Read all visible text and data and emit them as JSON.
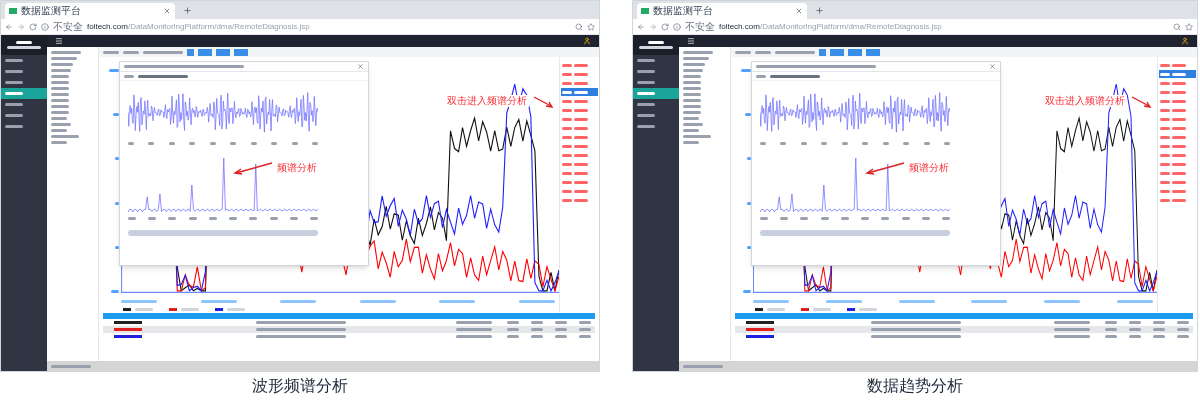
{
  "panels": [
    {
      "browser": {
        "tab_title": "数据监测平台",
        "security": "不安全",
        "url_host": "foltech.com",
        "url_path": "/DataMonitoringPlatform/dma/RemoteDiagnosis.jsp"
      },
      "sidebar": {
        "items": [
          {
            "selected": false
          },
          {
            "selected": false
          },
          {
            "selected": false
          },
          {
            "selected": true
          },
          {
            "selected": false
          },
          {
            "selected": false
          },
          {
            "selected": false
          }
        ]
      },
      "chart": {
        "annotation": "双击进入频谱分析"
      },
      "popup": {
        "annotation": "频谱分析"
      },
      "events": [
        {
          "selected": false
        },
        {
          "selected": false
        },
        {
          "selected": false
        },
        {
          "selected": true
        },
        {
          "selected": false
        },
        {
          "selected": false
        },
        {
          "selected": false
        },
        {
          "selected": false
        },
        {
          "selected": false
        },
        {
          "selected": false
        },
        {
          "selected": false
        },
        {
          "selected": false
        },
        {
          "selected": false
        },
        {
          "selected": false
        },
        {
          "selected": false
        },
        {
          "selected": false
        }
      ],
      "table": {
        "rows": [
          {
            "color": "#222222"
          },
          {
            "color": "#e02020"
          },
          {
            "color": "#2020e0"
          }
        ]
      },
      "caption": "波形频谱分析"
    },
    {
      "browser": {
        "tab_title": "数据监测平台",
        "security": "不安全",
        "url_host": "foltech.com",
        "url_path": "/DataMonitoringPlatform/dma/RemoteDiagnosis.jsp"
      },
      "sidebar": {
        "items": [
          {
            "selected": false
          },
          {
            "selected": false
          },
          {
            "selected": false
          },
          {
            "selected": true
          },
          {
            "selected": false
          },
          {
            "selected": false
          },
          {
            "selected": false
          }
        ]
      },
      "chart": {
        "annotation": "双击进入频谱分析"
      },
      "popup": {
        "annotation": "频谱分析"
      },
      "events": [
        {
          "selected": false
        },
        {
          "selected": true
        },
        {
          "selected": false
        },
        {
          "selected": false
        },
        {
          "selected": false
        },
        {
          "selected": false
        },
        {
          "selected": false
        },
        {
          "selected": false
        },
        {
          "selected": false
        },
        {
          "selected": false
        },
        {
          "selected": false
        },
        {
          "selected": false
        },
        {
          "selected": false
        },
        {
          "selected": false
        },
        {
          "selected": false
        },
        {
          "selected": false
        }
      ],
      "table": {
        "rows": [
          {
            "color": "#222222"
          },
          {
            "color": "#e02020"
          },
          {
            "color": "#2020e0"
          }
        ]
      },
      "caption": "数据趋势分析"
    }
  ]
}
